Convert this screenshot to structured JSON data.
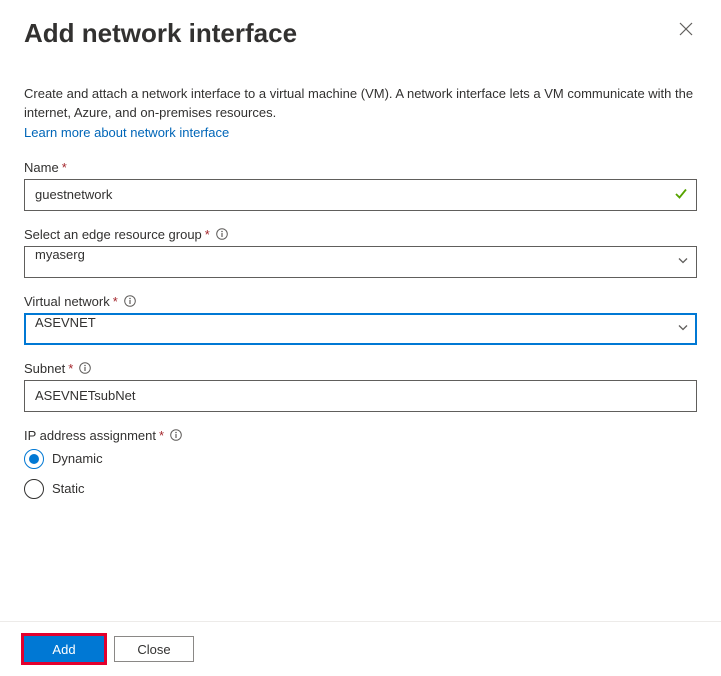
{
  "header": {
    "title": "Add network interface"
  },
  "description": "Create and attach a network interface to a virtual machine (VM). A network interface lets a VM communicate with the internet, Azure, and on-premises resources.",
  "learnMoreLink": "Learn more about network interface",
  "fields": {
    "name": {
      "label": "Name",
      "value": "guestnetwork"
    },
    "resourceGroup": {
      "label": "Select an edge resource group",
      "value": "myaserg"
    },
    "virtualNetwork": {
      "label": "Virtual network",
      "value": "ASEVNET"
    },
    "subnet": {
      "label": "Subnet",
      "value": "ASEVNETsubNet"
    },
    "ipAssignment": {
      "label": "IP address assignment",
      "options": {
        "dynamic": "Dynamic",
        "static": "Static"
      },
      "selected": "dynamic"
    }
  },
  "footer": {
    "addLabel": "Add",
    "closeLabel": "Close"
  }
}
